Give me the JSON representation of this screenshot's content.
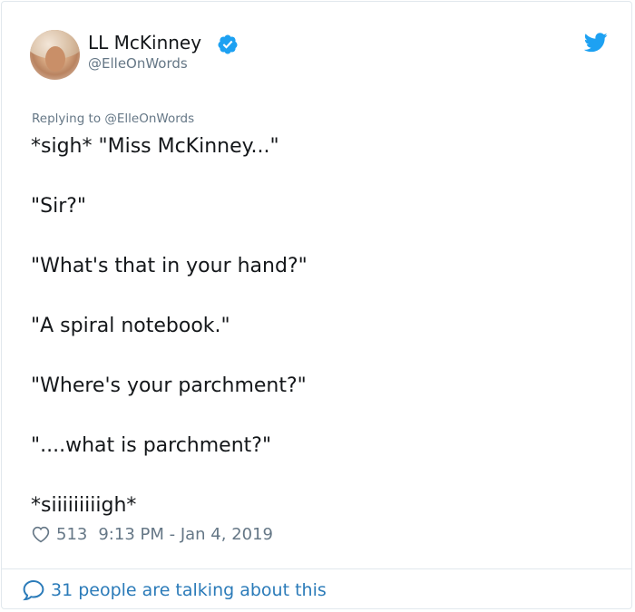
{
  "author": {
    "display_name": "LL McKinney",
    "handle": "@ElleOnWords",
    "verified": true
  },
  "reply_to": "Replying to @ElleOnWords",
  "tweet": {
    "lines": [
      "*sigh* \"Miss McKinney...\"",
      "\"Sir?\"",
      "\"What's that in your hand?\"",
      "\"A spiral notebook.\"",
      "\"Where's your parchment?\"",
      "\"....what is parchment?\"",
      "*siiiiiiiiigh*"
    ]
  },
  "meta": {
    "likes": "513",
    "timestamp": "9:13 PM - Jan 4, 2019"
  },
  "footer": {
    "talking_text": "31 people are talking about this"
  },
  "icons": {
    "verified": "verified-badge-icon",
    "platform": "twitter-bird-icon",
    "like": "heart-icon",
    "comments": "speech-bubble-icon"
  },
  "colors": {
    "brand_blue": "#1da1f2",
    "link_blue": "#2b7bb9",
    "text_primary": "#14171a",
    "text_secondary": "#657786",
    "border": "#e1e8ed"
  }
}
